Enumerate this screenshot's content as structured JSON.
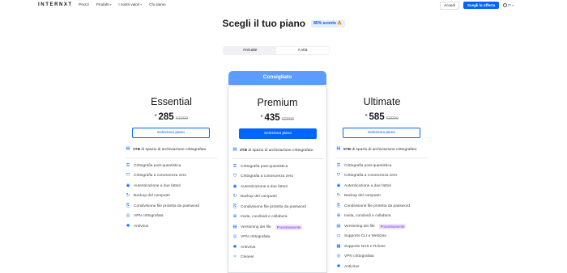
{
  "nav": {
    "logo": "INTERNXT",
    "links": [
      {
        "label": "Prezzi",
        "caret": false
      },
      {
        "label": "Prodotti",
        "caret": true
      },
      {
        "label": "I nostri valori",
        "caret": true
      },
      {
        "label": "Chi siamo",
        "caret": false
      }
    ],
    "login": "Accedi",
    "try": "Scegli la offerta",
    "lang": "IT"
  },
  "hero": {
    "title": "Scegli il tuo piano",
    "discount": "85% sconto 🔥"
  },
  "toggle": {
    "annual": "Annuale",
    "lifetime": "A vita",
    "selected": "lifetime"
  },
  "featured_badge": "Consigliato",
  "plans": [
    {
      "name": "Essential",
      "currency": "€",
      "price": "285",
      "old_price": "1900",
      "cta": "Seleziona piano",
      "storage_strong": "1TB",
      "storage_rest": " di spazio di archiviazione crittografato",
      "features": [
        {
          "icon": "key-icon",
          "glyph": "⚿",
          "text": "Crittografia post-quantistica",
          "soon": ""
        },
        {
          "icon": "shield-icon",
          "glyph": "⛉",
          "text": "Crittografia a conoscenza zero",
          "soon": ""
        },
        {
          "icon": "fingerprint-icon",
          "glyph": "◉",
          "text": "Autenticazione a due fattori",
          "soon": ""
        },
        {
          "icon": "backup-icon",
          "glyph": "↻",
          "text": "Backup del computer",
          "soon": ""
        },
        {
          "icon": "share-icon",
          "glyph": "⎘",
          "text": "Condivisione file protetta da password",
          "soon": ""
        },
        {
          "icon": "vpn-icon",
          "glyph": "◎",
          "text": "VPN crittografata",
          "soon": ""
        },
        {
          "icon": "bug-icon",
          "glyph": "✱",
          "text": "Antivirus",
          "soon": ""
        }
      ]
    },
    {
      "name": "Premium",
      "currency": "€",
      "price": "435",
      "old_price": "2900",
      "cta": "Seleziona piano",
      "storage_strong": "3TB",
      "storage_rest": " di spazio di archiviazione crittografato",
      "features": [
        {
          "icon": "key-icon",
          "glyph": "⚿",
          "text": "Crittografia post-quantistica",
          "soon": ""
        },
        {
          "icon": "shield-icon",
          "glyph": "⛉",
          "text": "Crittografia a conoscenza zero",
          "soon": ""
        },
        {
          "icon": "fingerprint-icon",
          "glyph": "◉",
          "text": "Autenticazione a due fattori",
          "soon": ""
        },
        {
          "icon": "backup-icon",
          "glyph": "↻",
          "text": "Backup del computer",
          "soon": ""
        },
        {
          "icon": "share-icon",
          "glyph": "⎘",
          "text": "Condivisione file protetta da password",
          "soon": ""
        },
        {
          "icon": "invite-icon",
          "glyph": "⊕",
          "text": "Invita, condividi e collabora",
          "soon": ""
        },
        {
          "icon": "version-icon",
          "glyph": "▤",
          "text": "Versioning dei file",
          "soon": "Prossimamente"
        },
        {
          "icon": "vpn-icon",
          "glyph": "◎",
          "text": "VPN crittografata",
          "soon": ""
        },
        {
          "icon": "bug-icon",
          "glyph": "✱",
          "text": "Antivirus",
          "soon": ""
        },
        {
          "icon": "cleaner-icon",
          "glyph": "✧",
          "text": "Cleaner",
          "soon": ""
        }
      ]
    },
    {
      "name": "Ultimate",
      "currency": "€",
      "price": "585",
      "old_price": "3900",
      "cta": "Seleziona piano",
      "storage_strong": "5TB",
      "storage_rest": " di spazio di archiviazione crittografato",
      "features": [
        {
          "icon": "key-icon",
          "glyph": "⚿",
          "text": "Crittografia post-quantistica",
          "soon": ""
        },
        {
          "icon": "shield-icon",
          "glyph": "⛉",
          "text": "Crittografia a conoscenza zero",
          "soon": ""
        },
        {
          "icon": "fingerprint-icon",
          "glyph": "◉",
          "text": "Autenticazione a due fattori",
          "soon": ""
        },
        {
          "icon": "backup-icon",
          "glyph": "↻",
          "text": "Backup del computer",
          "soon": ""
        },
        {
          "icon": "share-icon",
          "glyph": "⎘",
          "text": "Condivisione file protetta da password",
          "soon": ""
        },
        {
          "icon": "invite-icon",
          "glyph": "⊕",
          "text": "Invita, condividi e collabora",
          "soon": ""
        },
        {
          "icon": "version-icon",
          "glyph": "▤",
          "text": "Versioning dei file",
          "soon": "Prossimamente"
        },
        {
          "icon": "terminal-icon",
          "glyph": "▭",
          "text": "Supporto CLI e WebDav",
          "soon": ""
        },
        {
          "icon": "nas-icon",
          "glyph": "▦",
          "text": "Supporto NAS e Rclone",
          "soon": ""
        },
        {
          "icon": "vpn-icon",
          "glyph": "◎",
          "text": "VPN crittografata",
          "soon": ""
        },
        {
          "icon": "bug-icon",
          "glyph": "✱",
          "text": "Antivirus",
          "soon": ""
        }
      ]
    }
  ],
  "colors": {
    "accent": "#0066ff",
    "badge": "#5c9cff",
    "soon_bg": "#efe3ff",
    "soon_text": "#6b2fd1"
  }
}
